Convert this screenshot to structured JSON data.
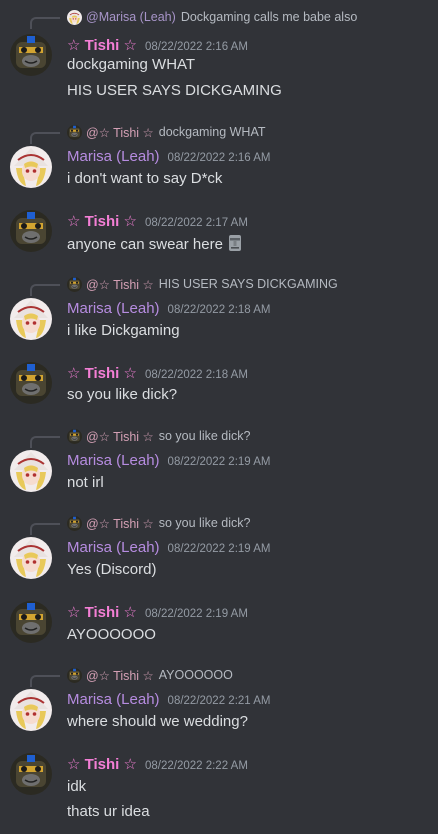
{
  "messages": [
    {
      "author": "☆ Tishi ☆",
      "author_kind": "tishi",
      "timestamp": "08/22/2022 2:16 AM",
      "reply": {
        "name": "@Marisa (Leah)",
        "kind": "marisa",
        "text": "Dockgaming calls me babe also"
      },
      "lines": [
        "dockgaming WHAT",
        "HIS USER SAYS DICKGAMING"
      ]
    },
    {
      "author": "Marisa (Leah)",
      "author_kind": "marisa",
      "timestamp": "08/22/2022 2:16 AM",
      "reply": {
        "name": "@☆ Tishi ☆",
        "kind": "tishi",
        "text": "dockgaming WHAT"
      },
      "lines": [
        "i don't want to say D*ck"
      ]
    },
    {
      "author": "☆ Tishi ☆",
      "author_kind": "tishi",
      "timestamp": "08/22/2022 2:17 AM",
      "reply": null,
      "lines": [
        "anyone can swear here"
      ],
      "emoji": "moai-icon"
    },
    {
      "author": "Marisa (Leah)",
      "author_kind": "marisa",
      "timestamp": "08/22/2022 2:18 AM",
      "reply": {
        "name": "@☆ Tishi ☆",
        "kind": "tishi",
        "text": "HIS USER SAYS DICKGAMING"
      },
      "lines": [
        "i like Dickgaming"
      ]
    },
    {
      "author": "☆ Tishi ☆",
      "author_kind": "tishi",
      "timestamp": "08/22/2022 2:18 AM",
      "reply": null,
      "lines": [
        "so you like dick?"
      ]
    },
    {
      "author": "Marisa (Leah)",
      "author_kind": "marisa",
      "timestamp": "08/22/2022 2:19 AM",
      "reply": {
        "name": "@☆ Tishi ☆",
        "kind": "tishi",
        "text": "so you like dick?"
      },
      "lines": [
        "not irl"
      ]
    },
    {
      "author": "Marisa (Leah)",
      "author_kind": "marisa",
      "timestamp": "08/22/2022 2:19 AM",
      "reply": {
        "name": "@☆ Tishi ☆",
        "kind": "tishi",
        "text": "so you like dick?"
      },
      "lines": [
        "Yes (Discord)"
      ]
    },
    {
      "author": "☆ Tishi ☆",
      "author_kind": "tishi",
      "timestamp": "08/22/2022 2:19 AM",
      "reply": null,
      "lines": [
        "AYOOOOOO"
      ]
    },
    {
      "author": "Marisa (Leah)",
      "author_kind": "marisa",
      "timestamp": "08/22/2022 2:21 AM",
      "reply": {
        "name": "@☆ Tishi ☆",
        "kind": "tishi",
        "text": "AYOOOOOO"
      },
      "lines": [
        "where should we wedding?"
      ]
    },
    {
      "author": "☆ Tishi ☆",
      "author_kind": "tishi",
      "timestamp": "08/22/2022 2:22 AM",
      "reply": null,
      "lines": [
        "idk",
        "thats ur idea"
      ]
    }
  ]
}
